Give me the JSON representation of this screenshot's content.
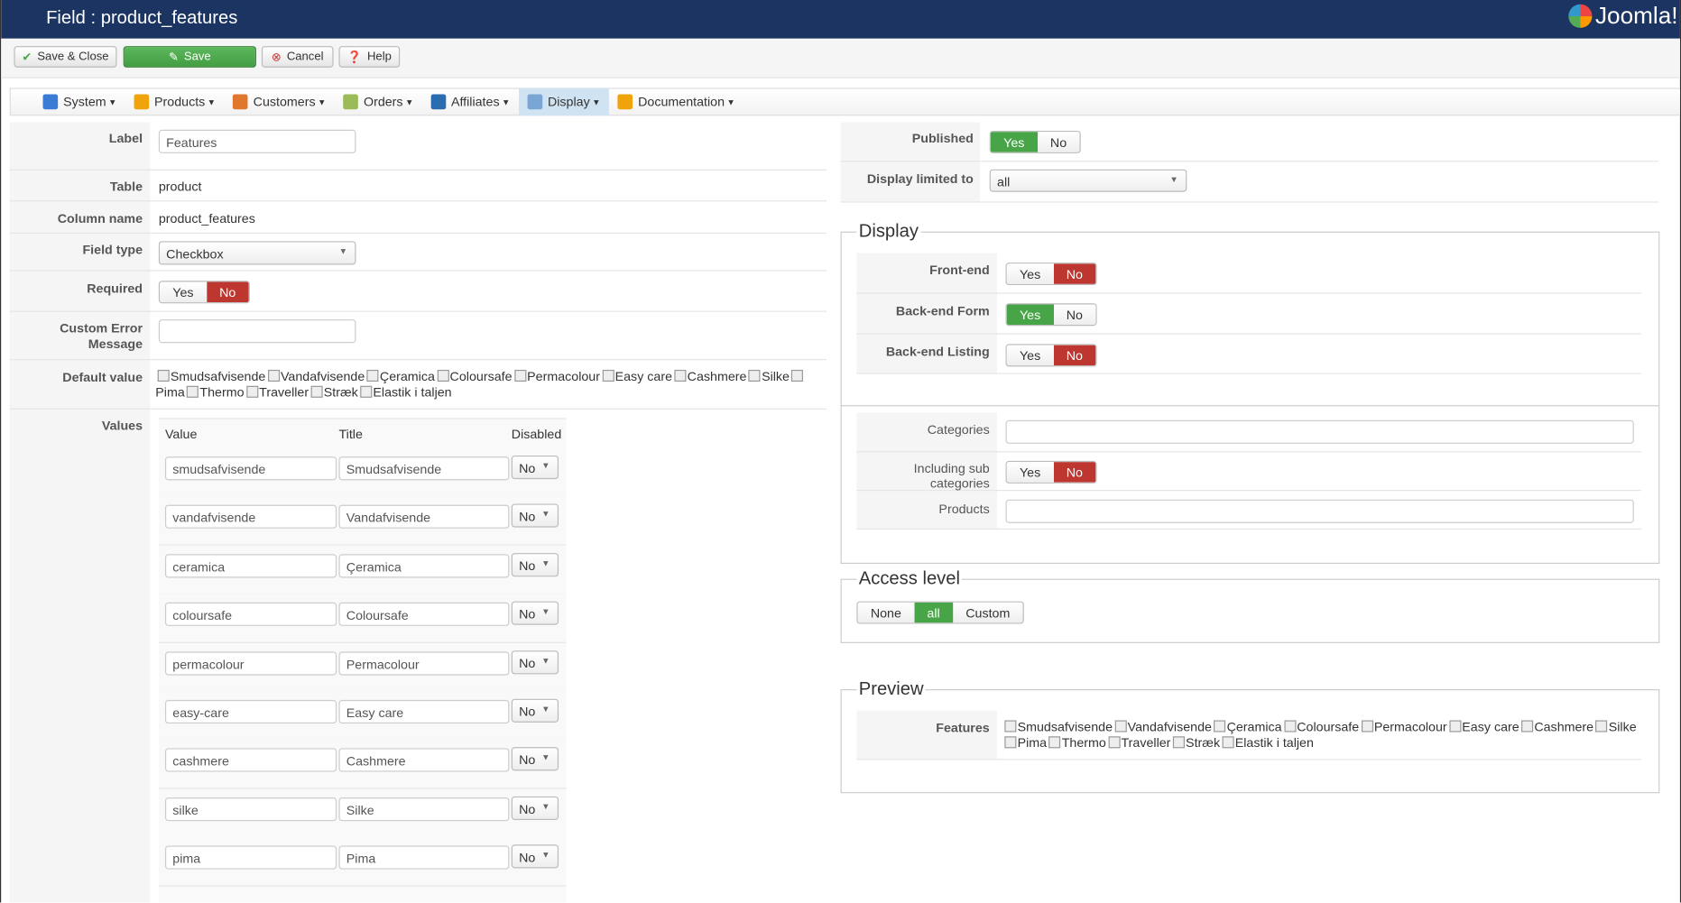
{
  "header": {
    "title": "Field : product_features",
    "logo": "Joomla!"
  },
  "toolbar": {
    "save_close": "Save & Close",
    "save": "Save",
    "cancel": "Cancel",
    "help": "Help"
  },
  "menu": [
    {
      "label": "System",
      "color": "#3a7bd5"
    },
    {
      "label": "Products",
      "color": "#f0a30a"
    },
    {
      "label": "Customers",
      "color": "#e0772d"
    },
    {
      "label": "Orders",
      "color": "#9bbb59"
    },
    {
      "label": "Affiliates",
      "color": "#2b6cb0"
    },
    {
      "label": "Display",
      "color": "#7aa6d6",
      "active": true
    },
    {
      "label": "Documentation",
      "color": "#f0a30a"
    }
  ],
  "form": {
    "label_label": "Label",
    "label_value": "Features",
    "table_label": "Table",
    "table_value": "product",
    "column_label": "Column name",
    "column_value": "product_features",
    "fieldtype_label": "Field type",
    "fieldtype_value": "Checkbox",
    "required_label": "Required",
    "yes": "Yes",
    "no": "No",
    "error_label1": "Custom Error",
    "error_label2": "Message",
    "error_value": "",
    "default_label": "Default value",
    "values_label": "Values",
    "values_headers": {
      "value": "Value",
      "title": "Title",
      "disabled": "Disabled"
    },
    "values": [
      {
        "value": "smudsafvisende",
        "title": "Smudsafvisende",
        "disabled": "No"
      },
      {
        "value": "vandafvisende",
        "title": "Vandafvisende",
        "disabled": "No"
      },
      {
        "value": "ceramica",
        "title": "Çeramica",
        "disabled": "No"
      },
      {
        "value": "coloursafe",
        "title": "Coloursafe",
        "disabled": "No"
      },
      {
        "value": "permacolour",
        "title": "Permacolour",
        "disabled": "No"
      },
      {
        "value": "easy-care",
        "title": "Easy care",
        "disabled": "No"
      },
      {
        "value": "cashmere",
        "title": "Cashmere",
        "disabled": "No"
      },
      {
        "value": "silke",
        "title": "Silke",
        "disabled": "No"
      },
      {
        "value": "pima",
        "title": "Pima",
        "disabled": "No"
      }
    ]
  },
  "options": [
    "Smudsafvisende",
    "Vandafvisende",
    "Çeramica",
    "Coloursafe",
    "Permacolour",
    "Easy care",
    "Cashmere",
    "Silke",
    "Pima",
    "Thermo",
    "Traveller",
    "Stræk",
    "Elastik i taljen"
  ],
  "right": {
    "published_label": "Published",
    "display_limited_label": "Display limited to",
    "display_limited_value": "all",
    "display_legend": "Display",
    "frontend_label": "Front-end",
    "backend_form_label": "Back-end Form",
    "backend_listing_label": "Back-end Listing",
    "categories_label": "Categories",
    "subcats_label": "Including sub categories",
    "products_label": "Products",
    "access_legend": "Access level",
    "access_none": "None",
    "access_all": "all",
    "access_custom": "Custom",
    "preview_legend": "Preview",
    "preview_label": "Features"
  },
  "colors": {
    "header": "#1b3461",
    "green": "#47a447",
    "red": "#bd362f"
  }
}
